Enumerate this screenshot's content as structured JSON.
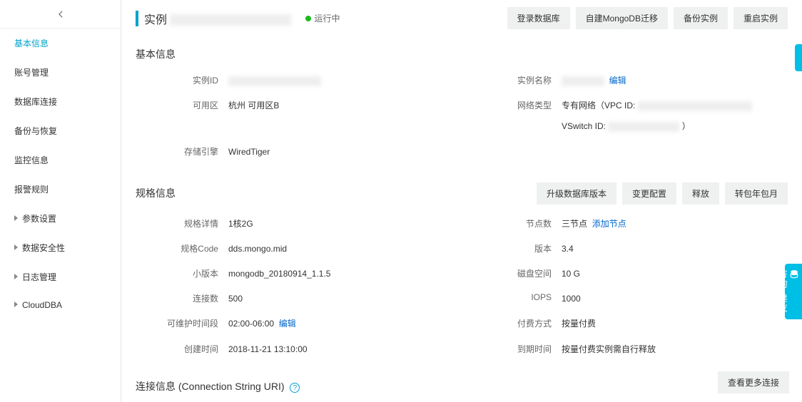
{
  "sidebar": {
    "items": [
      {
        "label": "基本信息",
        "active": true,
        "hasChildren": false
      },
      {
        "label": "账号管理",
        "active": false,
        "hasChildren": false
      },
      {
        "label": "数据库连接",
        "active": false,
        "hasChildren": false
      },
      {
        "label": "备份与恢复",
        "active": false,
        "hasChildren": false
      },
      {
        "label": "监控信息",
        "active": false,
        "hasChildren": false
      },
      {
        "label": "报警规则",
        "active": false,
        "hasChildren": false
      },
      {
        "label": "参数设置",
        "active": false,
        "hasChildren": true
      },
      {
        "label": "数据安全性",
        "active": false,
        "hasChildren": true
      },
      {
        "label": "日志管理",
        "active": false,
        "hasChildren": true
      },
      {
        "label": "CloudDBA",
        "active": false,
        "hasChildren": true
      }
    ]
  },
  "header": {
    "title_prefix": "实例",
    "status": "运行中",
    "actions": {
      "login_db": "登录数据库",
      "self_migrate": "自建MongoDB迁移",
      "backup": "备份实例",
      "restart": "重启实例"
    }
  },
  "basic_info": {
    "title": "基本信息",
    "left": {
      "instance_id_label": "实例ID",
      "zone_label": "可用区",
      "zone_value": "杭州 可用区B",
      "storage_engine_label": "存储引擎",
      "storage_engine_value": "WiredTiger"
    },
    "right": {
      "instance_name_label": "实例名称",
      "edit_link": "编辑",
      "network_type_label": "网络类型",
      "network_type_prefix": "专有网络（VPC ID:",
      "vswitch_prefix": "VSwitch ID:",
      "vswitch_suffix": "）"
    }
  },
  "spec_info": {
    "title": "规格信息",
    "actions": {
      "upgrade": "升级数据库版本",
      "change_config": "变更配置",
      "release": "释放",
      "switch_billing": "转包年包月"
    },
    "left": {
      "spec_detail_label": "规格详情",
      "spec_detail_value": "1核2G",
      "spec_code_label": "规格Code",
      "spec_code_value": "dds.mongo.mid",
      "minor_version_label": "小版本",
      "minor_version_value": "mongodb_20180914_1.1.5",
      "connections_label": "连接数",
      "connections_value": "500",
      "maint_window_label": "可维护时间段",
      "maint_window_value": "02:00-06:00",
      "maint_edit_link": "编辑",
      "create_time_label": "创建时间",
      "create_time_value": "2018-11-21 13:10:00"
    },
    "right": {
      "nodes_label": "节点数",
      "nodes_value": "三节点",
      "add_node_link": "添加节点",
      "version_label": "版本",
      "version_value": "3.4",
      "disk_label": "磁盘空间",
      "disk_value": "10 G",
      "iops_label": "IOPS",
      "iops_value": "1000",
      "billing_label": "付费方式",
      "billing_value": "按量付费",
      "expire_label": "到期时间",
      "expire_value": "按量付费实例需自行释放"
    }
  },
  "connection_info": {
    "title": "连接信息 (Connection String URI)",
    "more_btn": "查看更多连接"
  },
  "feedback": {
    "text": "咨询·建议"
  }
}
